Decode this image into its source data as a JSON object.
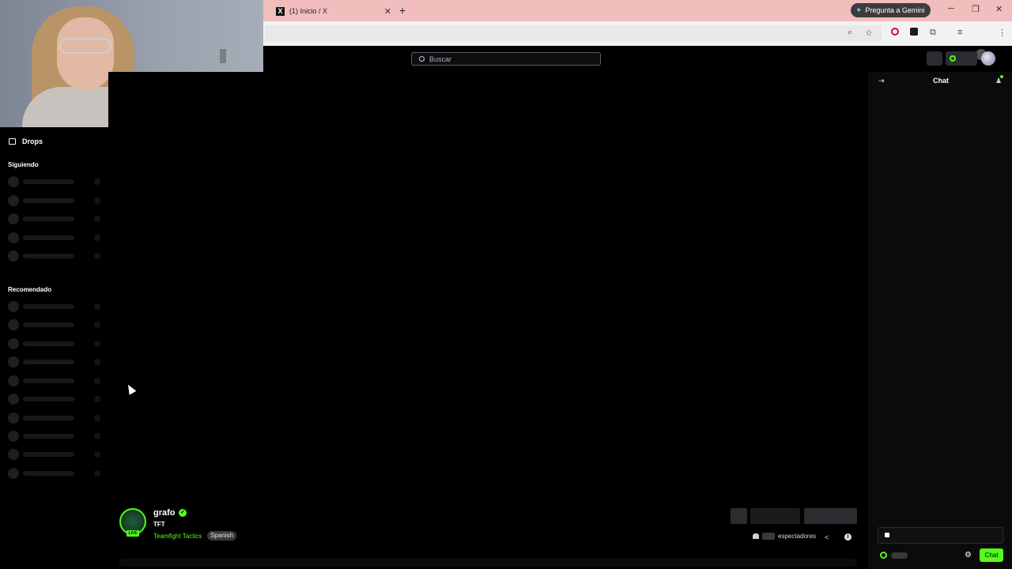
{
  "browser": {
    "tab_title": "(1) Inicio / X",
    "gemini_label": "Pregunta a Gemini"
  },
  "header": {
    "search_placeholder": "Buscar"
  },
  "sidebar": {
    "drops_label": "Drops",
    "following_title": "Siguiendo",
    "recommended_title": "Recomendado"
  },
  "stream": {
    "channel_name": "grafo",
    "live_badge": "LIVE",
    "title": "TFT",
    "category": "Teamfight Tactics",
    "language": "Spanish",
    "viewers_label": "espectadores"
  },
  "chat": {
    "title": "Chat",
    "send_label": "Chat"
  },
  "colors": {
    "accent": "#53fc18",
    "tabbar": "#f2bdbd",
    "background": "#000000"
  }
}
